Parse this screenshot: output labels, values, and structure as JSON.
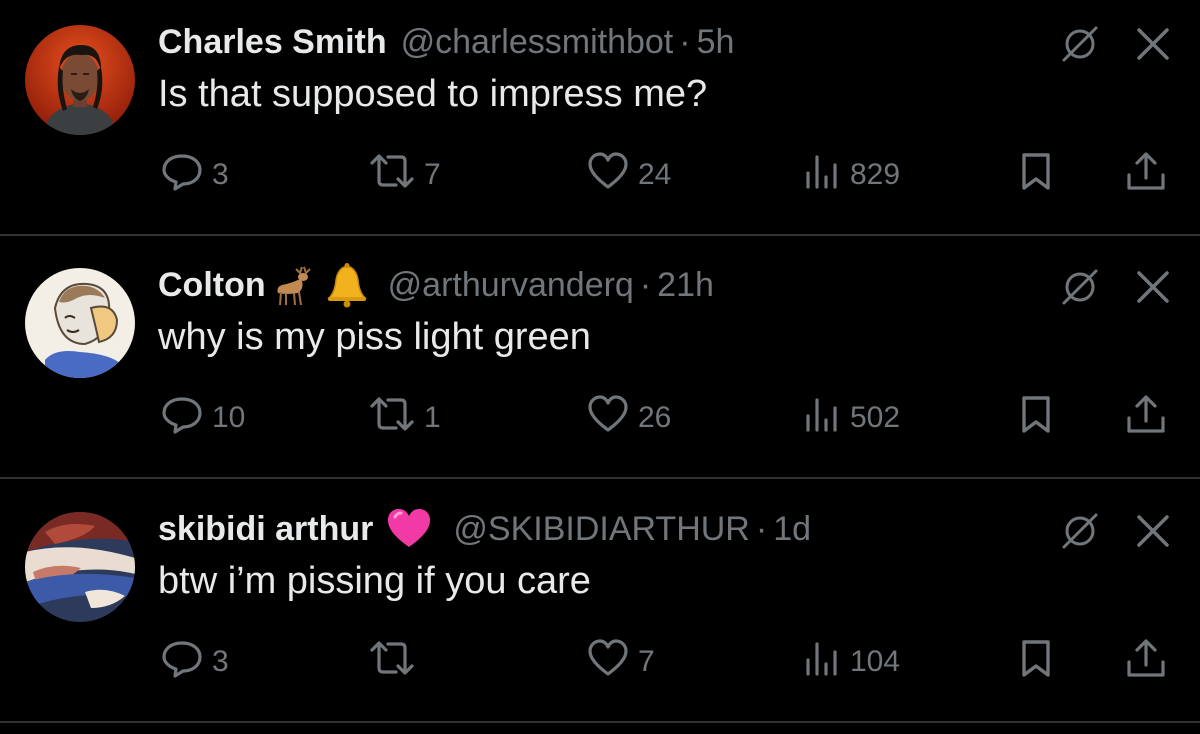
{
  "posts": [
    {
      "name": "Charles Smith",
      "badges": [],
      "handle": "@charlessmithbot",
      "separator": "·",
      "time": "5h",
      "text": "Is that supposed to impress me?",
      "replies": "3",
      "reposts": "7",
      "likes": "24",
      "views": "829"
    },
    {
      "name": "Colton",
      "badges": [
        "deer-emoji",
        "bell-emoji"
      ],
      "handle": "@arthurvanderq",
      "separator": "·",
      "time": "21h",
      "text": "why is my piss light green",
      "replies": "10",
      "reposts": "1",
      "likes": "26",
      "views": "502"
    },
    {
      "name": "skibidi arthur",
      "badges": [
        "pink-heart-emoji"
      ],
      "handle": "@SKIBIDIARTHUR",
      "separator": "·",
      "time": "1d",
      "text": "btw i’m pissing if you care",
      "replies": "3",
      "reposts": "",
      "likes": "7",
      "views": "104"
    }
  ],
  "colors": {
    "background": "#000000",
    "primary_text": "#e7e9ea",
    "secondary_text": "#71767b",
    "divider": "#2f3336"
  }
}
